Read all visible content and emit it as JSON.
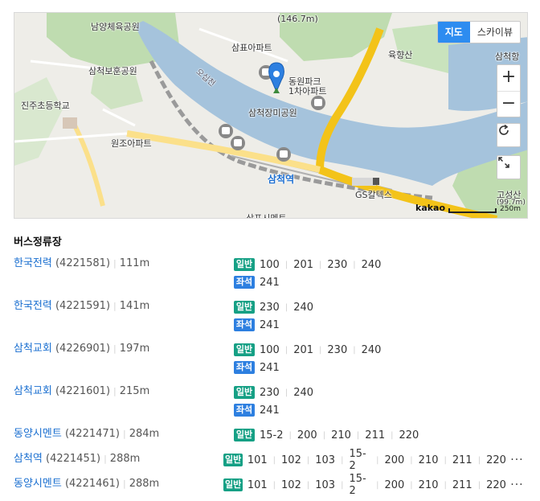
{
  "map": {
    "maptype_buttons": [
      {
        "label": "지도"
      },
      {
        "label": "스카이뷰"
      }
    ],
    "zoom_in_label": "+",
    "zoom_out_label": "−",
    "labels": {
      "elevation": "(146.7m)",
      "park_namyang": "남양체육공원",
      "samchuk_bohun": "삼척보훈공원",
      "jinju_school": "진주초등학교",
      "samyo_apt": "삼표아파트",
      "dongwon_apt": "동원파크\n1차아파트",
      "samchuk_rose_park": "삼척장미공원",
      "osipcheon": "오십천",
      "yukhyangsan": "육향산",
      "samchuk_port": "삼척항",
      "wonjo_apt": "원조아파트",
      "samchuk_station": "삼척역",
      "gs_caltex": "GS칼텍스",
      "goseongsan": "고성산",
      "goseongsan_elev": "(99.7m)",
      "samyo_cement": "삼표시멘트"
    },
    "scale": {
      "logo": "kakao",
      "distance": "250m"
    }
  },
  "section_title": "버스정류장",
  "stops": [
    {
      "name": "한국전력",
      "id": "(4221581)",
      "distance": "111m",
      "routes": [
        {
          "type": "일반",
          "kind": "general",
          "numbers": [
            "100",
            "201",
            "230",
            "240"
          ]
        },
        {
          "type": "좌석",
          "kind": "seat",
          "numbers": [
            "241"
          ]
        }
      ]
    },
    {
      "name": "한국전력",
      "id": "(4221591)",
      "distance": "141m",
      "routes": [
        {
          "type": "일반",
          "kind": "general",
          "numbers": [
            "230",
            "240"
          ]
        },
        {
          "type": "좌석",
          "kind": "seat",
          "numbers": [
            "241"
          ]
        }
      ]
    },
    {
      "name": "삼척교회",
      "id": "(4226901)",
      "distance": "197m",
      "routes": [
        {
          "type": "일반",
          "kind": "general",
          "numbers": [
            "100",
            "201",
            "230",
            "240"
          ]
        },
        {
          "type": "좌석",
          "kind": "seat",
          "numbers": [
            "241"
          ]
        }
      ]
    },
    {
      "name": "삼척교회",
      "id": "(4221601)",
      "distance": "215m",
      "routes": [
        {
          "type": "일반",
          "kind": "general",
          "numbers": [
            "230",
            "240"
          ]
        },
        {
          "type": "좌석",
          "kind": "seat",
          "numbers": [
            "241"
          ]
        }
      ]
    },
    {
      "name": "동양시멘트",
      "id": "(4221471)",
      "distance": "284m",
      "routes": [
        {
          "type": "일반",
          "kind": "general",
          "numbers": [
            "15-2",
            "200",
            "210",
            "211",
            "220"
          ]
        }
      ]
    },
    {
      "name": "삼척역",
      "id": "(4221451)",
      "distance": "288m",
      "more": "···",
      "routes": [
        {
          "type": "일반",
          "kind": "general",
          "numbers": [
            "101",
            "102",
            "103",
            "15-2",
            "200",
            "210",
            "211",
            "220"
          ]
        }
      ]
    },
    {
      "name": "동양시멘트",
      "id": "(4221461)",
      "distance": "288m",
      "more": "···",
      "routes": [
        {
          "type": "일반",
          "kind": "general",
          "numbers": [
            "101",
            "102",
            "103",
            "15-2",
            "200",
            "210",
            "211",
            "220"
          ]
        }
      ]
    }
  ]
}
